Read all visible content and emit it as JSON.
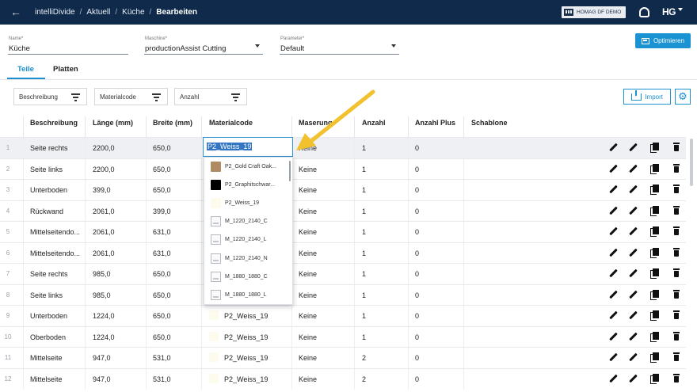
{
  "header": {
    "breadcrumb": [
      "intelliDivide",
      "Aktuell",
      "Küche",
      "Bearbeiten"
    ],
    "company": "HOMAG DF DEMO",
    "logo": "HG"
  },
  "form": {
    "name": {
      "label": "Name*",
      "value": "Küche"
    },
    "maschine": {
      "label": "Maschine*",
      "value": "productionAssist Cutting"
    },
    "parameter": {
      "label": "Parameter*",
      "value": "Default"
    },
    "optimize_label": "Optimieren"
  },
  "tabs": [
    {
      "label": "Teile",
      "active": true
    },
    {
      "label": "Platten",
      "active": false
    }
  ],
  "filters": {
    "beschreibung": "Beschreibung",
    "materialcode": "Materialcode",
    "anzahl": "Anzahl",
    "import_label": "Import"
  },
  "columns": [
    "Beschreibung",
    "Länge (mm)",
    "Breite (mm)",
    "Materialcode",
    "Maserung",
    "Anzahl",
    "Anzahl Plus",
    "Schablone"
  ],
  "editor": {
    "value": "P2_Weiss_19",
    "options": [
      {
        "label": "P2_Gold Craft Oak...",
        "swatch": "#b08a63"
      },
      {
        "label": "P2_Graphitschwar...",
        "swatch": "#000000"
      },
      {
        "label": "P2_Weiss_19",
        "swatch": "#fdfbeb"
      },
      {
        "label": "M_1220_2140_C",
        "swatch": null
      },
      {
        "label": "M_1220_2140_L",
        "swatch": null
      },
      {
        "label": "M_1220_2140_N",
        "swatch": null
      },
      {
        "label": "M_1880_1880_C",
        "swatch": null
      },
      {
        "label": "M_1880_1880_L",
        "swatch": null
      }
    ]
  },
  "rows": [
    {
      "idx": "1",
      "desc": "Seite rechts",
      "laenge": "2200,0",
      "breite": "650,0",
      "mat": "",
      "maserung": "Keine",
      "anzahl": "1",
      "plus": "0"
    },
    {
      "idx": "2",
      "desc": "Seite links",
      "laenge": "2200,0",
      "breite": "650,0",
      "mat": "",
      "maserung": "Keine",
      "anzahl": "1",
      "plus": "0"
    },
    {
      "idx": "3",
      "desc": "Unterboden",
      "laenge": "399,0",
      "breite": "650,0",
      "mat": "",
      "maserung": "Keine",
      "anzahl": "1",
      "plus": "0"
    },
    {
      "idx": "4",
      "desc": "Rückwand",
      "laenge": "2061,0",
      "breite": "399,0",
      "mat": "",
      "maserung": "Keine",
      "anzahl": "1",
      "plus": "0"
    },
    {
      "idx": "5",
      "desc": "Mittelseitendo...",
      "laenge": "2061,0",
      "breite": "631,0",
      "mat": "",
      "maserung": "Keine",
      "anzahl": "1",
      "plus": "0"
    },
    {
      "idx": "6",
      "desc": "Mittelseitendo...",
      "laenge": "2061,0",
      "breite": "631,0",
      "mat": "",
      "maserung": "Keine",
      "anzahl": "1",
      "plus": "0"
    },
    {
      "idx": "7",
      "desc": "Seite rechts",
      "laenge": "985,0",
      "breite": "650,0",
      "mat": "",
      "maserung": "Keine",
      "anzahl": "1",
      "plus": "0"
    },
    {
      "idx": "8",
      "desc": "Seite links",
      "laenge": "985,0",
      "breite": "650,0",
      "mat": "",
      "maserung": "Keine",
      "anzahl": "1",
      "plus": "0"
    },
    {
      "idx": "9",
      "desc": "Unterboden",
      "laenge": "1224,0",
      "breite": "650,0",
      "mat": "P2_Weiss_19",
      "maserung": "Keine",
      "anzahl": "1",
      "plus": "0"
    },
    {
      "idx": "10",
      "desc": "Oberboden",
      "laenge": "1224,0",
      "breite": "650,0",
      "mat": "P2_Weiss_19",
      "maserung": "Keine",
      "anzahl": "1",
      "plus": "0"
    },
    {
      "idx": "11",
      "desc": "Mittelseite",
      "laenge": "947,0",
      "breite": "531,0",
      "mat": "P2_Weiss_19",
      "maserung": "Keine",
      "anzahl": "2",
      "plus": "0"
    },
    {
      "idx": "12",
      "desc": "Mittelseite",
      "laenge": "947,0",
      "breite": "531,0",
      "mat": "P2_Weiss_19",
      "maserung": "Keine",
      "anzahl": "2",
      "plus": "0"
    }
  ],
  "colors": {
    "navy": "#0f2a4a",
    "accent": "#1b92d2",
    "arrow": "#f2c12e"
  }
}
